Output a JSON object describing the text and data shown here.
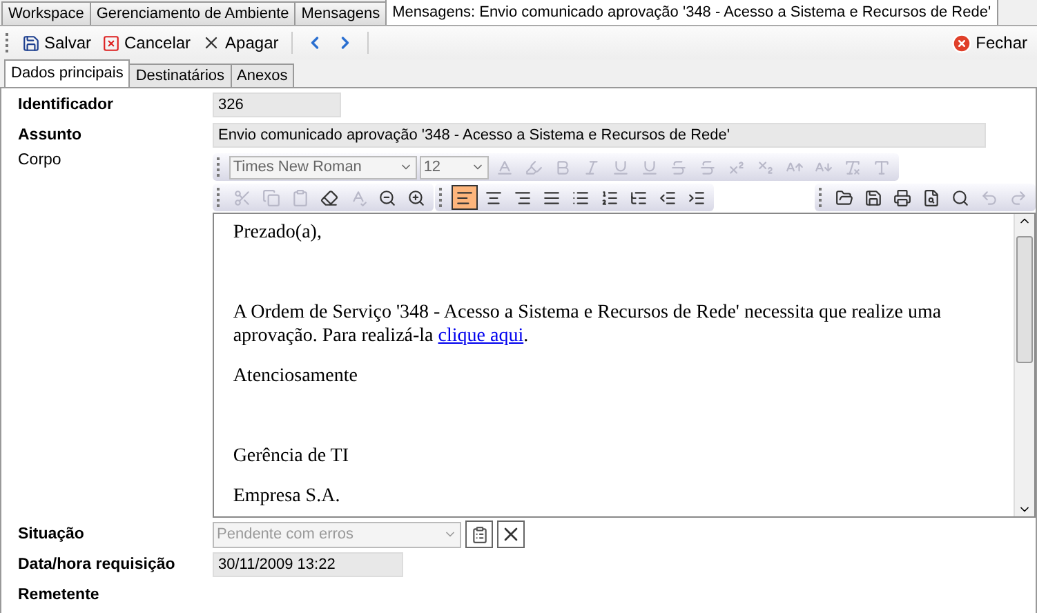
{
  "doc_tabs": [
    {
      "label": "Workspace",
      "selected": false
    },
    {
      "label": "Gerenciamento de Ambiente",
      "selected": false
    },
    {
      "label": "Mensagens",
      "selected": false
    },
    {
      "label": "Mensagens: Envio comunicado aprovação '348 - Acesso a Sistema e Recursos de Rede'",
      "selected": true
    }
  ],
  "toolbar": {
    "buttons": [
      {
        "kind": "save",
        "label": "Salvar"
      },
      {
        "kind": "cancel",
        "label": "Cancelar"
      },
      {
        "kind": "delete",
        "label": "Apagar"
      },
      {
        "kind": "prev"
      },
      {
        "kind": "next"
      }
    ],
    "close_button": {
      "label": "Fechar"
    }
  },
  "form_tabs": [
    {
      "label": "Dados principais",
      "selected": true
    },
    {
      "label": "Destinatários",
      "selected": false
    },
    {
      "label": "Anexos",
      "selected": false
    }
  ],
  "fields": [
    {
      "label": "Identificador",
      "value": "326"
    },
    {
      "label": "Assunto",
      "value": "Envio comunicado aprovação '348 - Acesso a Sistema e Recursos de Rede'"
    }
  ],
  "body": {
    "label": "Corpo",
    "font": "Times New Roman",
    "size": "12",
    "format_buttons": [
      {
        "kind": "font-color",
        "disabled": true
      },
      {
        "kind": "highlight",
        "disabled": true
      },
      {
        "kind": "bold",
        "disabled": true
      },
      {
        "kind": "italic",
        "disabled": true
      },
      {
        "kind": "underline",
        "disabled": true
      },
      {
        "kind": "double-underline",
        "disabled": true
      },
      {
        "kind": "strike",
        "disabled": true
      },
      {
        "kind": "double-strike",
        "disabled": true
      },
      {
        "kind": "superscript",
        "disabled": true
      },
      {
        "kind": "subscript",
        "disabled": true
      },
      {
        "kind": "grow",
        "disabled": true
      },
      {
        "kind": "shrink",
        "disabled": true
      },
      {
        "kind": "clear",
        "disabled": true
      },
      {
        "kind": "type",
        "disabled": true
      }
    ],
    "edit_buttons": [
      {
        "kind": "cut",
        "disabled": true
      },
      {
        "kind": "copy",
        "disabled": true
      },
      {
        "kind": "paste",
        "disabled": true
      },
      {
        "kind": "eraser",
        "disabled": false
      },
      {
        "kind": "spell",
        "disabled": true
      },
      {
        "kind": "zoom-out",
        "disabled": false
      },
      {
        "kind": "zoom-in",
        "disabled": false
      }
    ],
    "align_buttons": [
      {
        "kind": "align-left",
        "selected": true
      },
      {
        "kind": "align-center",
        "selected": false
      },
      {
        "kind": "align-right",
        "selected": false
      },
      {
        "kind": "justify",
        "selected": false
      },
      {
        "kind": "list",
        "selected": false
      },
      {
        "kind": "list-ordered",
        "selected": false
      },
      {
        "kind": "list-indent",
        "selected": false
      },
      {
        "kind": "outdent",
        "selected": false
      },
      {
        "kind": "indent",
        "selected": false
      }
    ],
    "file_buttons": [
      {
        "kind": "open",
        "disabled": false
      },
      {
        "kind": "save",
        "disabled": false
      },
      {
        "kind": "print",
        "disabled": false
      },
      {
        "kind": "print-preview",
        "disabled": false
      },
      {
        "kind": "find",
        "disabled": false
      },
      {
        "kind": "undo",
        "disabled": true
      },
      {
        "kind": "redo",
        "disabled": true
      }
    ],
    "paragraphs": [
      {
        "text": "Prezado(a),"
      },
      {
        "kind": "blank"
      },
      {
        "text": "A Ordem de Serviço '348 - Acesso a Sistema e Recursos de Rede' necessita que realize uma aprovação. Para realizá-la ",
        "link": "clique aqui",
        "after": "."
      },
      {
        "text": "Atenciosamente"
      },
      {
        "kind": "blank"
      },
      {
        "text": "Gerência de TI"
      },
      {
        "text": "Empresa S.A."
      }
    ]
  },
  "status": {
    "label": "Situação",
    "value": "Pendente com erros",
    "disabled": true
  },
  "request_date": {
    "label": "Data/hora requisição",
    "value": "30/11/2009 13:22"
  },
  "sender": {
    "label": "Remetente"
  }
}
